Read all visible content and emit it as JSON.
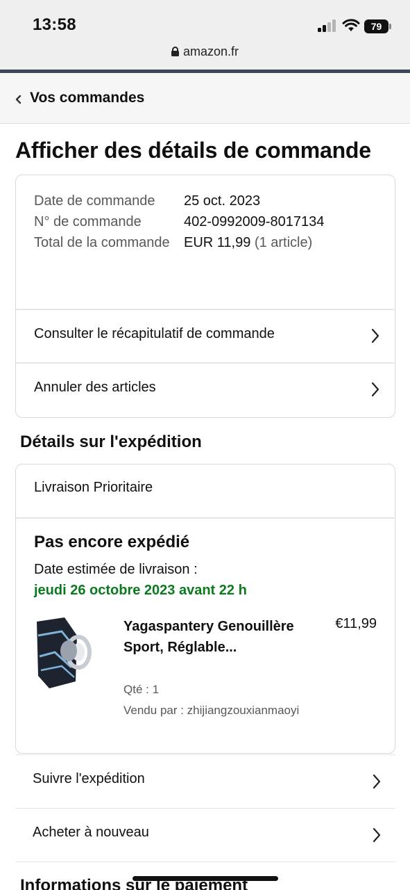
{
  "status_bar": {
    "time": "13:58",
    "battery": "79"
  },
  "browser": {
    "url": "amazon.fr"
  },
  "back_nav": {
    "label": "Vos commandes"
  },
  "page_title": "Afficher des détails de commande",
  "order_summary": {
    "date_label": "Date de commande",
    "date_value": "25 oct. 2023",
    "number_label": "N° de commande",
    "number_value": "402-0992009-8017134",
    "total_label": "Total de la commande",
    "total_value": "EUR 11,99",
    "total_count": "(1 article)"
  },
  "summary_links": [
    {
      "label": "Consulter le récapitulatif de commande"
    },
    {
      "label": "Annuler des articles"
    }
  ],
  "shipping_section_title": "Détails sur l'expédition",
  "shipment": {
    "method": "Livraison Prioritaire",
    "status": "Pas encore expédié",
    "eta_label": "Date estimée de livraison :",
    "eta_date": "jeudi 26 octobre 2023 avant 22 h",
    "eta_color": "#0a7a1f",
    "product": {
      "title": "Yagaspantery Genouillère Sport, Réglable...",
      "price": "€11,99",
      "qty": "Qté : 1",
      "seller": "Vendu par : zhijiangzouxianmaoyi",
      "image_icon": "knee-brace-image"
    }
  },
  "shipment_links": [
    {
      "label": "Suivre l'expédition"
    },
    {
      "label": "Acheter à nouveau"
    }
  ],
  "next_section_title": "Informations sur le paiement"
}
